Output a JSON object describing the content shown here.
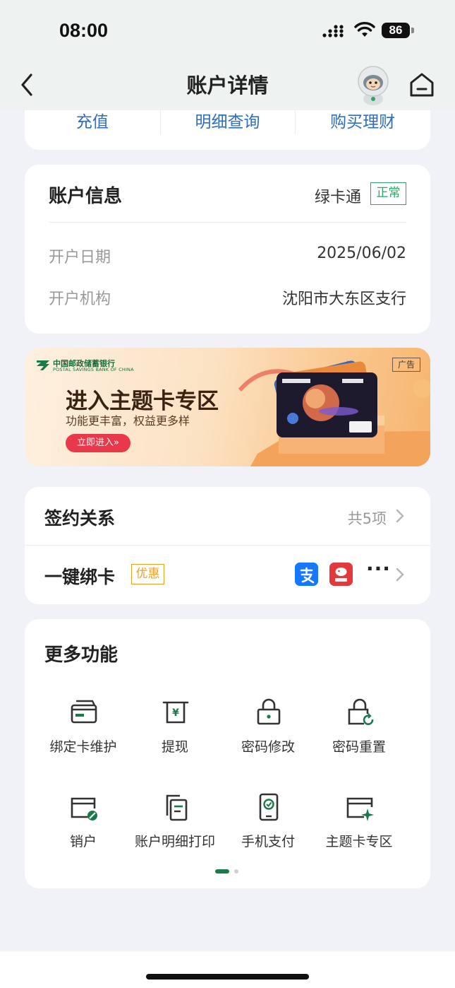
{
  "status_bar": {
    "time": "08:00",
    "battery": "86"
  },
  "header": {
    "title": "账户详情"
  },
  "quick_actions": [
    "充值",
    "明细查询",
    "购买理财"
  ],
  "account_info": {
    "title": "账户信息",
    "card_type": "绿卡通",
    "status": "正常",
    "rows": [
      {
        "label": "开户日期",
        "value": "2025/06/02"
      },
      {
        "label": "开户机构",
        "value": "沈阳市大东区支行"
      }
    ]
  },
  "banner": {
    "bank_name": "中国邮政储蓄银行",
    "bank_name_en": "POSTAL SAVINGS BANK OF CHINA",
    "ad_tag": "广告",
    "headline": "进入主题卡专区",
    "subtitle": "功能更丰富，权益更多样",
    "cta": "立即进入»"
  },
  "relations": {
    "contract_label": "签约关系",
    "contract_count": "共5项",
    "bind_label": "一键绑卡",
    "bind_tag": "优惠",
    "more": "···"
  },
  "more_features": {
    "title": "更多功能",
    "items": [
      {
        "label": "绑定卡维护",
        "icon": "card-icon"
      },
      {
        "label": "提现",
        "icon": "withdraw-icon"
      },
      {
        "label": "密码修改",
        "icon": "lock-icon"
      },
      {
        "label": "密码重置",
        "icon": "lock-reset-icon"
      },
      {
        "label": "销户",
        "icon": "close-account-icon"
      },
      {
        "label": "账户明细打印",
        "icon": "print-statement-icon"
      },
      {
        "label": "手机支付",
        "icon": "mobile-pay-icon"
      },
      {
        "label": "主题卡专区",
        "icon": "theme-card-icon"
      }
    ]
  },
  "colors": {
    "brand_green": "#1a7a4a",
    "link_blue": "#2e6ec0",
    "status_green": "#2aa66a",
    "promo_orange": "#f0a020",
    "cta_red": "#e8384a"
  }
}
